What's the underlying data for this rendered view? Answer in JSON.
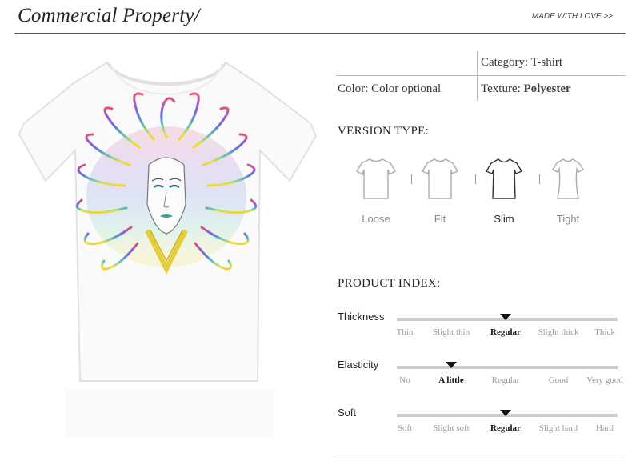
{
  "header": {
    "title": "Commercial Property/",
    "tagline": "MADE WITH LOVE >>"
  },
  "specs": {
    "category_label": "Category:",
    "category_value": "T-shirt",
    "color_label": "Color:",
    "color_value": "Color optional",
    "texture_label": "Texture:",
    "texture_value": "Polyester"
  },
  "version": {
    "title": "VERSION TYPE:",
    "items": [
      {
        "label": "Loose",
        "active": false
      },
      {
        "label": "Fit",
        "active": false
      },
      {
        "label": "Slim",
        "active": true
      },
      {
        "label": "Tight",
        "active": false
      }
    ]
  },
  "product_index": {
    "title": "PRODUCT INDEX:",
    "rows": [
      {
        "name": "Thickness",
        "levels": [
          "Thin",
          "Slight thin",
          "Regular",
          "Slight thick",
          "Thick"
        ],
        "selected": "Regular"
      },
      {
        "name": "Elasticity",
        "levels": [
          "No",
          "A little",
          "Regular",
          "Good",
          "Very good"
        ],
        "selected": "A little"
      },
      {
        "name": "Soft",
        "levels": [
          "Soft",
          "Slight soft",
          "Regular",
          "Slight hard",
          "Hard"
        ],
        "selected": "Regular"
      }
    ]
  },
  "colors": {
    "marker": "#111111",
    "track": "#cccccc"
  }
}
